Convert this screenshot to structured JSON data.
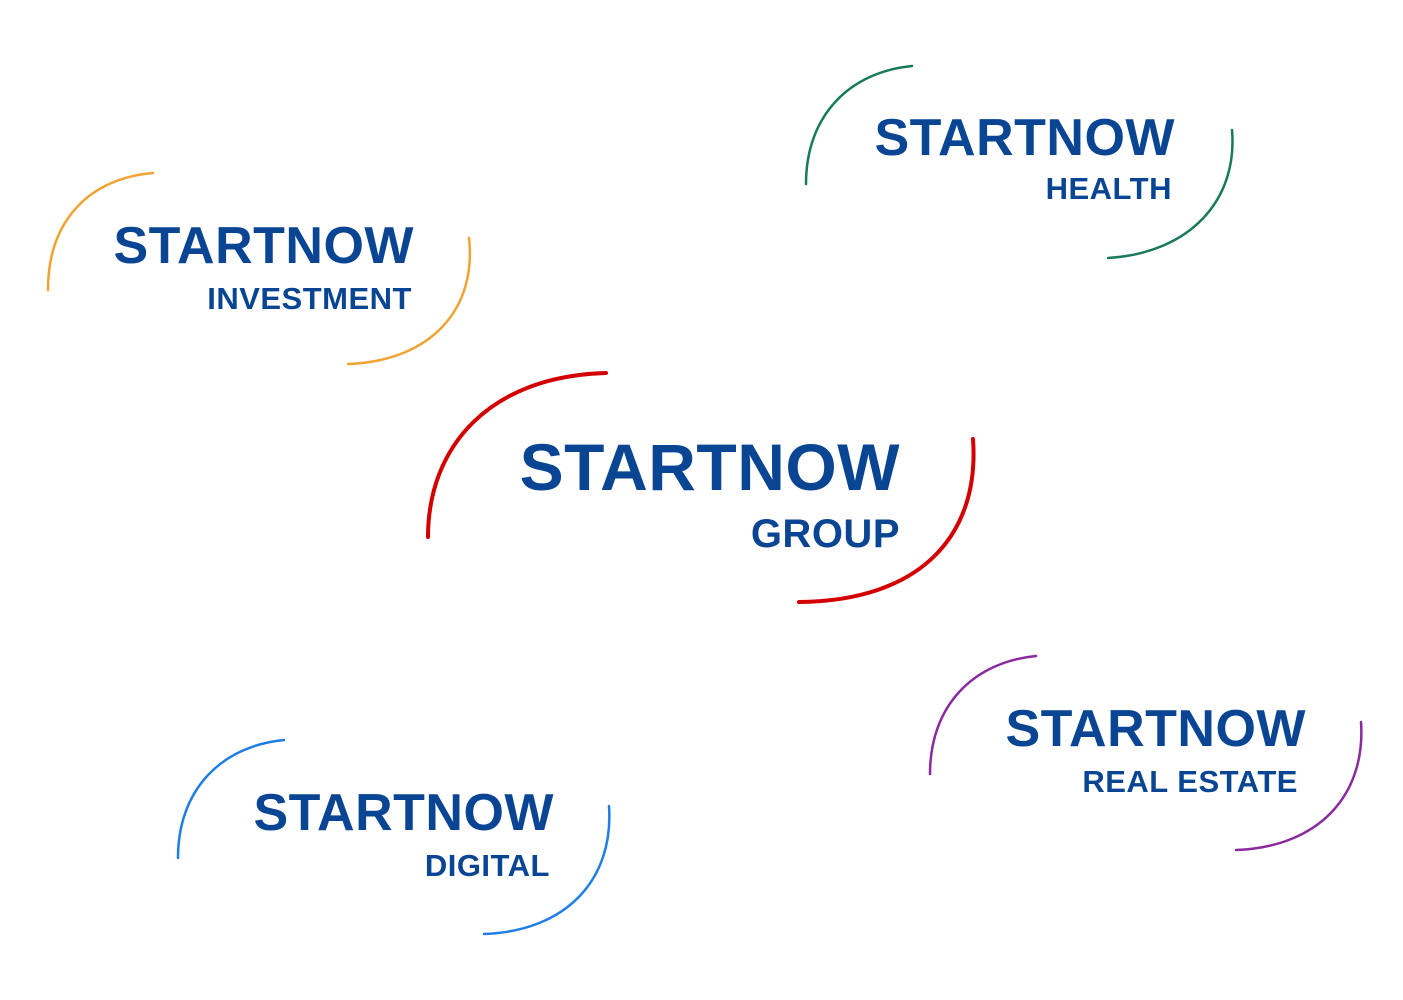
{
  "colors": {
    "text": "#0a4594",
    "health_accent": "#177a5b",
    "investment_accent": "#f0a331",
    "group_accent": "#d40000",
    "realestate_accent": "#8a2a9e",
    "digital_accent": "#1f7de6"
  },
  "logos": {
    "health": {
      "brand": "STARTNOW",
      "division": "HEALTH"
    },
    "investment": {
      "brand": "STARTNOW",
      "division": "INVESTMENT"
    },
    "group": {
      "brand": "STARTNOW",
      "division": "GROUP"
    },
    "realestate": {
      "brand": "STARTNOW",
      "division": "REAL ESTATE"
    },
    "digital": {
      "brand": "STARTNOW",
      "division": "DIGITAL"
    }
  }
}
